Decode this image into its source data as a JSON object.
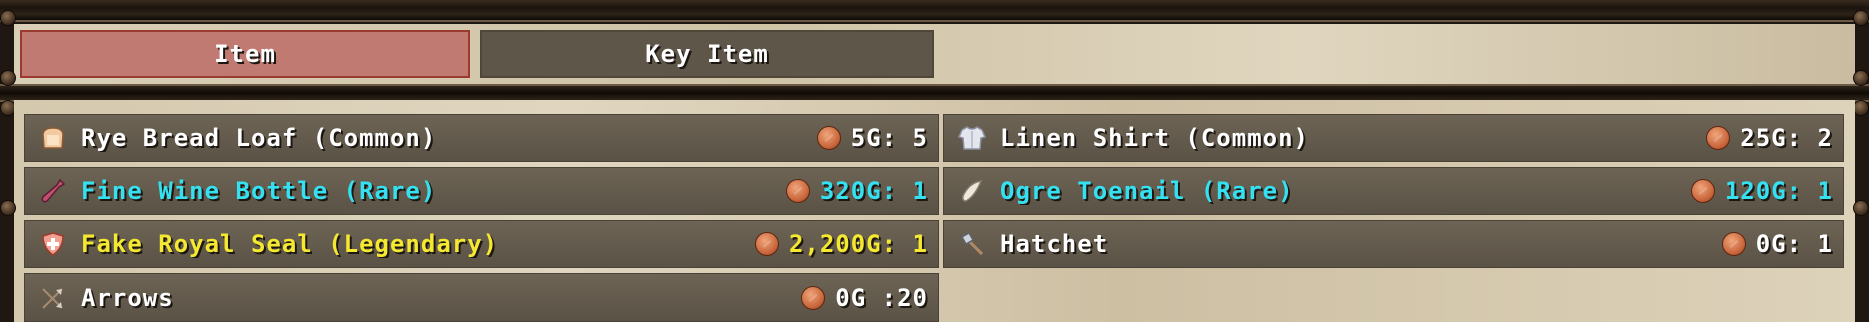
{
  "tabs": [
    {
      "label": "Item",
      "active": true
    },
    {
      "label": "Key Item",
      "active": false
    }
  ],
  "colors": {
    "common": "#ffffff",
    "rare": "#35e0f0",
    "legendary": "#f5e830",
    "active_tab": "#c07a72"
  },
  "items": [
    {
      "name": "Rye Bread Loaf (Common)",
      "price": "5G",
      "qty": "5",
      "rarity": "common",
      "icon": "bread-icon"
    },
    {
      "name": "Linen Shirt (Common)",
      "price": "25G",
      "qty": "2",
      "rarity": "common",
      "icon": "shirt-icon"
    },
    {
      "name": "Fine Wine Bottle (Rare)",
      "price": "320G",
      "qty": "1",
      "rarity": "rare",
      "icon": "wine-bottle-icon"
    },
    {
      "name": "Ogre Toenail (Rare)",
      "price": "120G",
      "qty": "1",
      "rarity": "rare",
      "icon": "toenail-icon"
    },
    {
      "name": "Fake Royal Seal (Legendary)",
      "price": "2,200G",
      "qty": "1",
      "rarity": "legendary",
      "icon": "shield-icon"
    },
    {
      "name": "Hatchet",
      "price": "0G",
      "qty": "1",
      "rarity": "common",
      "icon": "hatchet-icon"
    },
    {
      "name": "Arrows",
      "price": "0G",
      "qty": "20",
      "rarity": "common",
      "icon": "arrows-icon"
    }
  ]
}
